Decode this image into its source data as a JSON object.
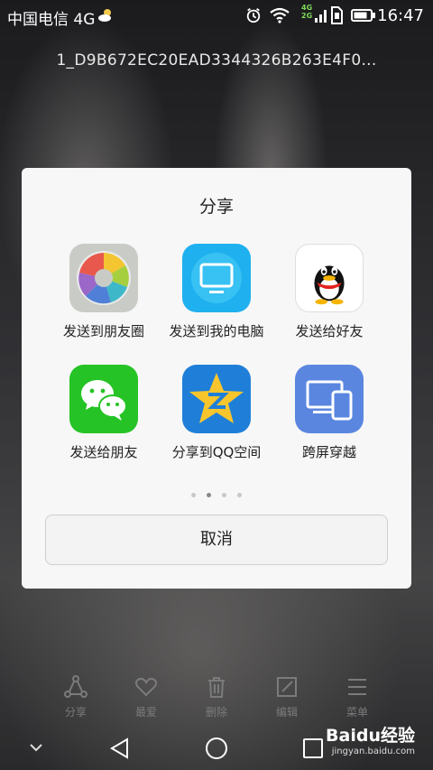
{
  "status_bar": {
    "carrier": "中国电信 4G",
    "time": "16:47",
    "net_badge_top": "4G",
    "net_badge_bottom": "2G"
  },
  "file_name": "1_D9B672EC20EAD3344326B263E4F0...",
  "share_dialog": {
    "title": "分享",
    "apps": [
      {
        "label": "发送到朋友圈",
        "icon": "moments-camera-aperture-icon"
      },
      {
        "label": "发送到我的电脑",
        "icon": "my-computer-monitor-icon"
      },
      {
        "label": "发送给好友",
        "icon": "qq-penguin-icon"
      },
      {
        "label": "发送给朋友",
        "icon": "wechat-icon"
      },
      {
        "label": "分享到QQ空间",
        "icon": "qzone-star-icon"
      },
      {
        "label": "跨屏穿越",
        "icon": "cross-screen-devices-icon"
      }
    ],
    "page_count": 4,
    "active_page": 2,
    "cancel_label": "取消"
  },
  "toolbar": {
    "share": "分享",
    "favorite": "最爱",
    "delete": "删除",
    "edit": "编辑",
    "menu": "菜单"
  },
  "watermark": {
    "brand": "Baidu经验",
    "url": "jingyan.baidu.com"
  },
  "colors": {
    "dialog_bg": "#f7f7f7",
    "toolbar_text": "#7b7b7d"
  }
}
